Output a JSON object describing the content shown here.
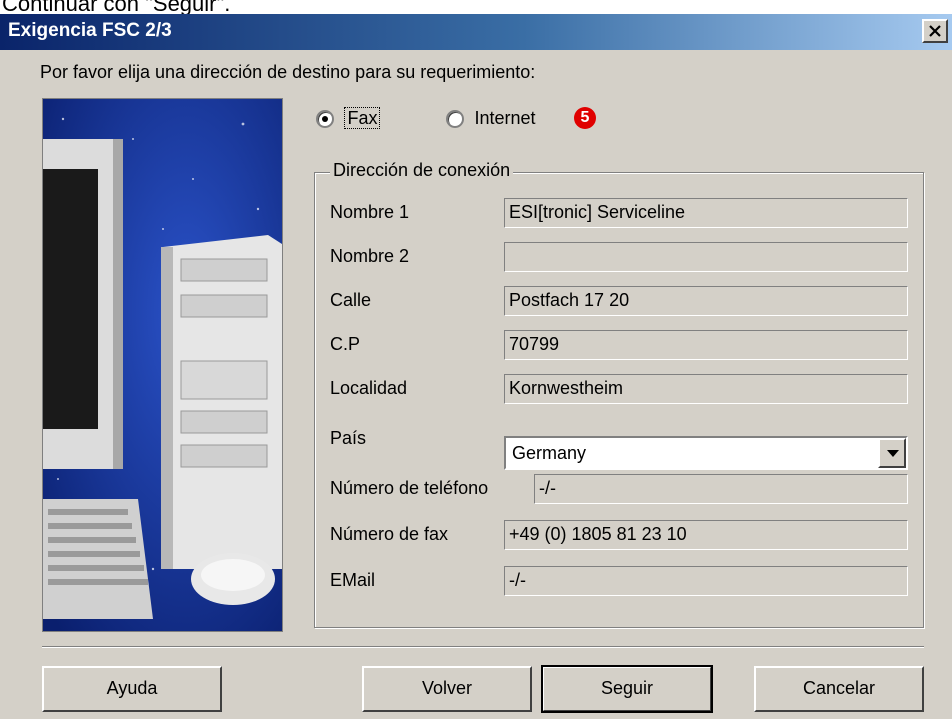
{
  "caption_fragment": "Continuar con \"Seguir\".",
  "window": {
    "title": "Exigencia FSC 2/3"
  },
  "prompt": "Por favor elija una dirección de destino para su requerimiento:",
  "destination": {
    "options": [
      {
        "label": "Fax",
        "selected": true
      },
      {
        "label": "Internet",
        "selected": false
      }
    ],
    "badge": "5"
  },
  "connection": {
    "legend": "Dirección de conexión",
    "fields": [
      {
        "label": "Nombre 1",
        "value": "ESI[tronic] Serviceline"
      },
      {
        "label": "Nombre 2",
        "value": ""
      },
      {
        "label": "Calle",
        "value": "Postfach 17 20"
      },
      {
        "label": "C.P",
        "value": "70799"
      },
      {
        "label": "Localidad",
        "value": "Kornwestheim"
      },
      {
        "label": "País",
        "value": "Germany"
      },
      {
        "label": "Número de teléfono",
        "value": "-/-"
      },
      {
        "label": "Número de fax",
        "value": "+49 (0) 1805 81 23 10"
      },
      {
        "label": "EMail",
        "value": "-/-"
      }
    ]
  },
  "buttons": {
    "help": "Ayuda",
    "back": "Volver",
    "next": "Seguir",
    "cancel": "Cancelar"
  },
  "colors": {
    "title_start": "#0a246a",
    "title_end": "#a6caf0",
    "face": "#d4d0c8",
    "badge": "#e00000"
  }
}
